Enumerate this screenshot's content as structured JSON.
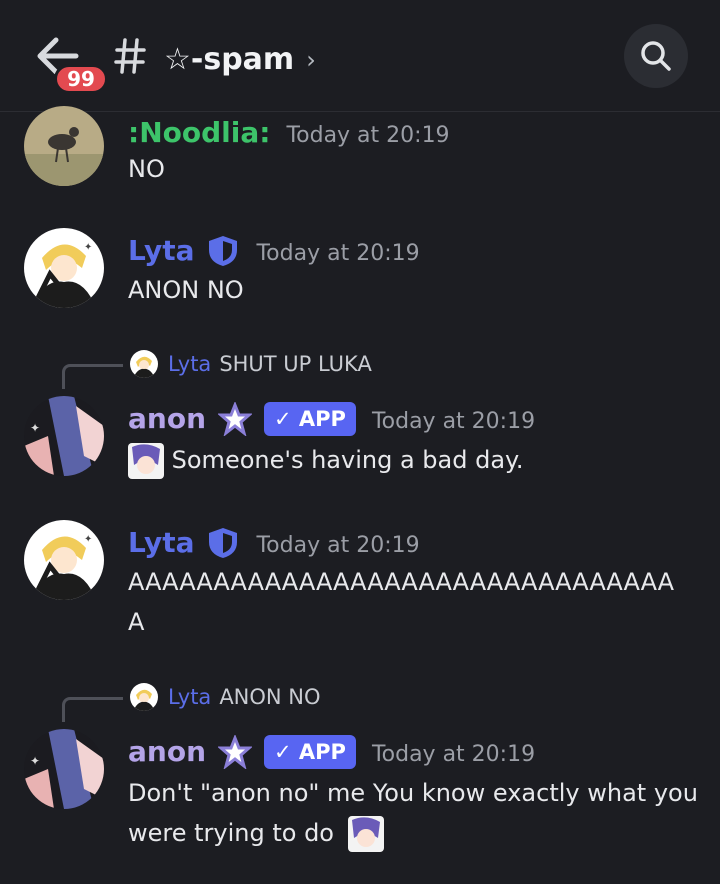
{
  "header": {
    "unread_count": "99",
    "channel_name": "☆-spam",
    "chevron": "›"
  },
  "colors": {
    "noodlia": "#3dc46a",
    "lyta": "#5865f2",
    "anon": "#b4a4e8",
    "app_badge": "#5865f2",
    "unread_badge": "#e34a50"
  },
  "messages": [
    {
      "author": ":Noodlia:",
      "timestamp": "Today at 20:19",
      "text": "NO"
    },
    {
      "author": "Lyta",
      "timestamp": "Today at 20:19",
      "text": "ANON NO"
    },
    {
      "reply": {
        "author": "Lyta",
        "text": "SHUT UP LUKA"
      },
      "author": "anon",
      "badge": "✓ APP",
      "timestamp": "Today at 20:19",
      "text": "Someone's having a bad day."
    },
    {
      "author": "Lyta",
      "timestamp": "Today at 20:19",
      "text": "AAAAAAAAAAAAAAAAAAAAAAAAAAAAAAAAA"
    },
    {
      "reply": {
        "author": "Lyta",
        "text": "ANON NO"
      },
      "author": "anon",
      "badge": "✓ APP",
      "timestamp": "Today at 20:19",
      "text": "Don't \"anon no\" me You know exactly what you were trying to do"
    }
  ]
}
